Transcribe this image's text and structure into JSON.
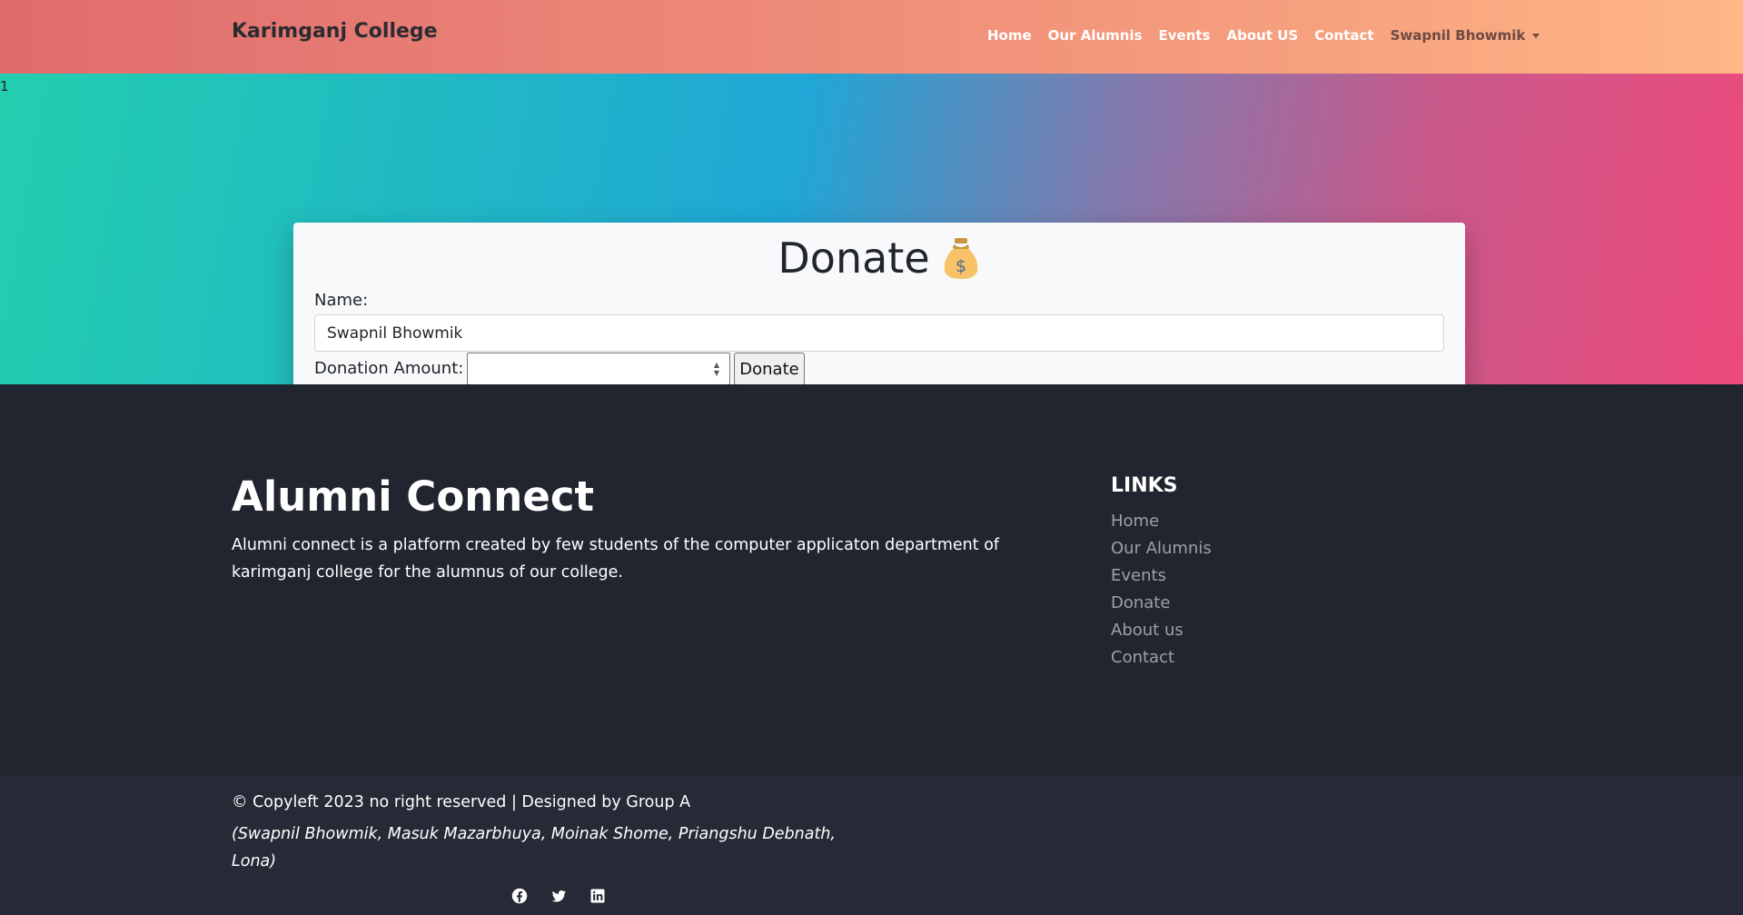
{
  "navbar": {
    "brand": "Karimganj College",
    "links": [
      "Home",
      "Our Alumnis",
      "Events",
      "About US",
      "Contact"
    ],
    "user": "Swapnil Bhowmik"
  },
  "stray_text": "1",
  "donate_card": {
    "title": "Donate",
    "icon": "money-bag-icon",
    "name_label": "Name:",
    "name_value": "Swapnil Bhowmik",
    "amount_label": "Donation Amount:",
    "amount_value": "",
    "button_label": "Donate"
  },
  "footer": {
    "title": "Alumni Connect",
    "description": "Alumni connect is a platform created by few students of the computer applicaton department of karimganj college for the alumnus of our college.",
    "links_heading": "LINKS",
    "links": [
      "Home",
      "Our Alumnis",
      "Events",
      "Donate",
      "About us",
      "Contact"
    ],
    "copyright": "© Copyleft 2023 no right reserved | Designed by Group A",
    "authors": "(Swapnil Bhowmik, Masuk Mazarbhuya, Moinak Shome, Priangshu Debnath, Lona)",
    "social": [
      "facebook-icon",
      "twitter-icon",
      "linkedin-icon"
    ]
  },
  "colors": {
    "navbar_start": "#e06c6e",
    "navbar_end": "#ffb786",
    "hero_start": "#22cfae",
    "hero_end": "#ee4a7c",
    "footer_bg": "#212530"
  }
}
